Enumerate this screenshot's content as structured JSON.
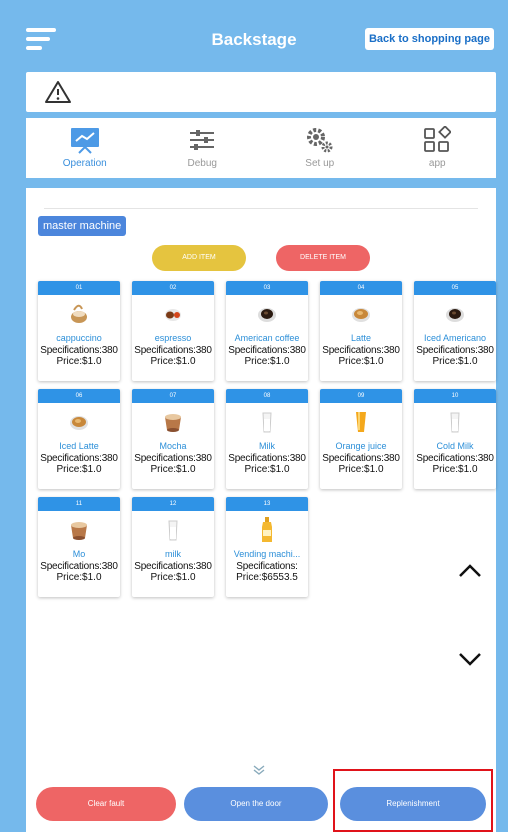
{
  "header": {
    "title": "Backstage",
    "back_label": "Back to shopping page"
  },
  "alert": {
    "icon": "warning-icon"
  },
  "tabs": [
    {
      "label": "Operation",
      "icon": "operation-icon",
      "active": true
    },
    {
      "label": "Debug",
      "icon": "sliders-icon",
      "active": false
    },
    {
      "label": "Set up",
      "icon": "gears-icon",
      "active": false
    },
    {
      "label": "app",
      "icon": "app-grid-icon",
      "active": false
    }
  ],
  "panel": {
    "machine_label": "master machine",
    "add_label": "ADD ITEM",
    "delete_label": "DELETE ITEM"
  },
  "products": [
    {
      "num": "01",
      "name": "cappuccino",
      "spec": "Specifications:380",
      "price": "Price:$1.0",
      "icon": "cappuccino-cup-icon"
    },
    {
      "num": "02",
      "name": "espresso",
      "spec": "Specifications:380",
      "price": "Price:$1.0",
      "icon": "espresso-cup-icon"
    },
    {
      "num": "03",
      "name": "American coffee",
      "spec": "Specifications:380",
      "price": "Price:$1.0",
      "icon": "coffee-cup-icon"
    },
    {
      "num": "04",
      "name": "Latte",
      "spec": "Specifications:380",
      "price": "Price:$1.0",
      "icon": "latte-cup-icon"
    },
    {
      "num": "05",
      "name": "Iced Americano",
      "spec": "Specifications:380",
      "price": "Price:$1.0",
      "icon": "coffee-cup-icon"
    },
    {
      "num": "06",
      "name": "Iced Latte",
      "spec": "Specifications:380",
      "price": "Price:$1.0",
      "icon": "latte-cup-icon"
    },
    {
      "num": "07",
      "name": "Mocha",
      "spec": "Specifications:380",
      "price": "Price:$1.0",
      "icon": "mocha-cup-icon"
    },
    {
      "num": "08",
      "name": "Milk",
      "spec": "Specifications:380",
      "price": "Price:$1.0",
      "icon": "milk-glass-icon"
    },
    {
      "num": "09",
      "name": "Orange juice",
      "spec": "Specifications:380",
      "price": "Price:$1.0",
      "icon": "juice-glass-icon"
    },
    {
      "num": "10",
      "name": "Cold Milk",
      "spec": "Specifications:380",
      "price": "Price:$1.0",
      "icon": "milk-glass-icon"
    },
    {
      "num": "11",
      "name": "Mo",
      "spec": "Specifications:380",
      "price": "Price:$1.0",
      "icon": "mocha-cup-icon"
    },
    {
      "num": "12",
      "name": "milk",
      "spec": "Specifications:380",
      "price": "Price:$1.0",
      "icon": "milk-glass-icon"
    },
    {
      "num": "13",
      "name": "Vending machi...",
      "spec": "Specifications:",
      "price": "Price:$6553.5",
      "icon": "juice-bottle-icon"
    }
  ],
  "footer": {
    "clear_label": "Clear fault",
    "door_label": "Open the door",
    "replenish_label": "Replenishment"
  },
  "colors": {
    "background": "#75b9ec",
    "accent": "#2f93e6",
    "danger": "#ee6565",
    "warning": "#e5c43f",
    "highlight": "#e0131a"
  }
}
